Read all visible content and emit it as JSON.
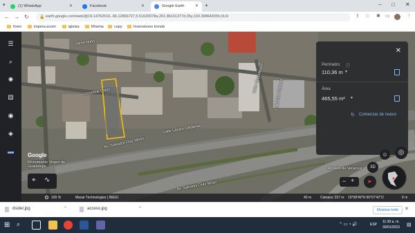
{
  "browser": {
    "tabs": [
      {
        "title": "(1) WhatsApp",
        "color": "#25d366"
      },
      {
        "title": "Facebook",
        "color": "#1877f2"
      },
      {
        "title": "Google Earth",
        "color": "#4285f4"
      }
    ],
    "url": "earth.google.com/web/@19.14762516,-96.12866727,5.51620078a,201.86101377d,35y,103.39864935h,0t,0r",
    "bookmarks": [
      "forex",
      "impera.ecom",
      "iglesia",
      "Rhema",
      "copy",
      "Inversiones Inmob"
    ]
  },
  "map": {
    "street_labels": [
      "Jaime Nuñó",
      "Cristóbal Colón",
      "Calle Chapultepec",
      "Calle Lázaro Cárdenas",
      "Av. Salvador Díaz Mirón",
      "Av. Salvador Díaz Mirón",
      "Calle Ruiz Cortines"
    ],
    "place_labels": [
      "Monumento Virgen de Guadalupe",
      "Acuario de Veracruz"
    ],
    "logo": "Google",
    "status": {
      "zoom": "100 %",
      "attribution": "Maxar Technologies | INEGI",
      "scale": "40 m",
      "camera": "Cámara: 257 m",
      "coords": "19°08'49\"N 96°07'42\"O",
      "elev": "6 m"
    },
    "view_toggle": "3D"
  },
  "measure_panel": {
    "perimeter_label": "Perímetro",
    "perimeter_value": "110,36 m",
    "area_label": "Área",
    "area_value": "465,55 m²",
    "restart_label": "Comenzar de nuevo"
  },
  "downloads": {
    "files": [
      "dsider.jpg",
      "acceso.jpg"
    ],
    "show_all": "Mostrar todo"
  },
  "taskbar": {
    "lang": "ESP",
    "time": "11:39 a. m.",
    "date": "30/01/2023"
  }
}
